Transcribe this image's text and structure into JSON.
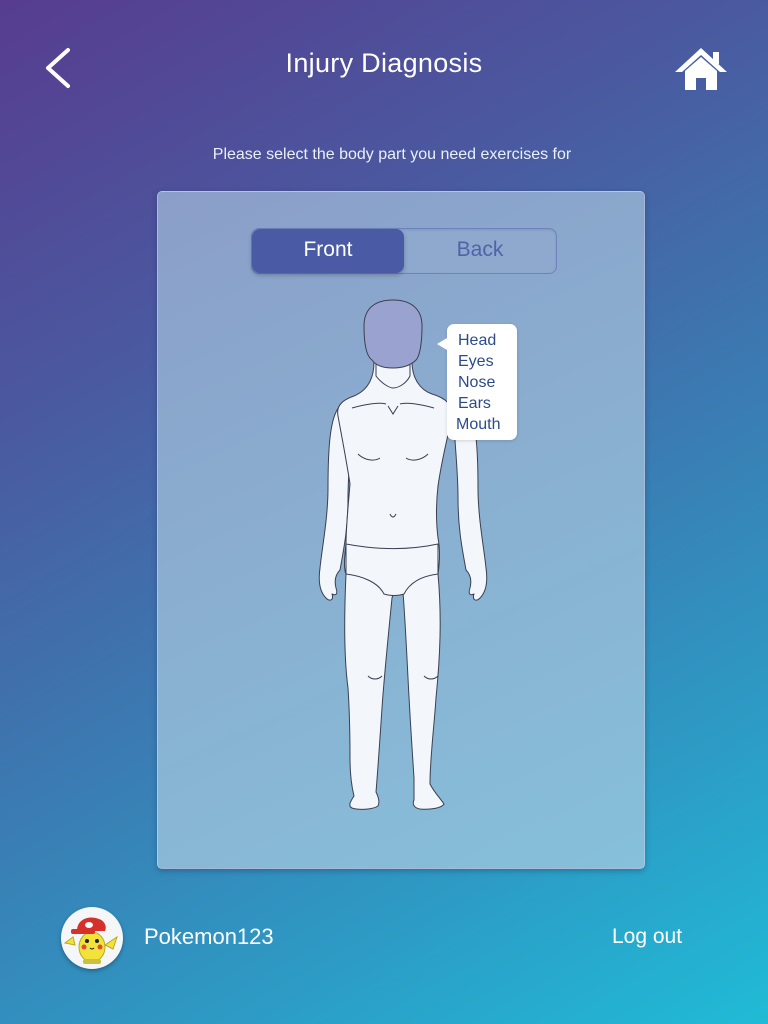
{
  "header": {
    "title": "Injury Diagnosis",
    "back_icon": "chevron-left-icon",
    "home_icon": "home-icon"
  },
  "subtitle": "Please select the body part you need exercises for",
  "toggle": {
    "front_label": "Front",
    "back_label": "Back",
    "selected": "Front"
  },
  "body_map": {
    "selected_region": "Head",
    "highlight_color": "#9aa3cf",
    "menu_items": [
      "Head",
      "Eyes",
      "Nose",
      "Ears",
      "Mouth"
    ]
  },
  "footer": {
    "username": "Pokemon123",
    "logout_label": "Log out",
    "avatar_icon": "pikachu-avatar"
  },
  "colors": {
    "toggle_active": "#4a5aa4",
    "bubble_text": "#2c4a8c"
  }
}
